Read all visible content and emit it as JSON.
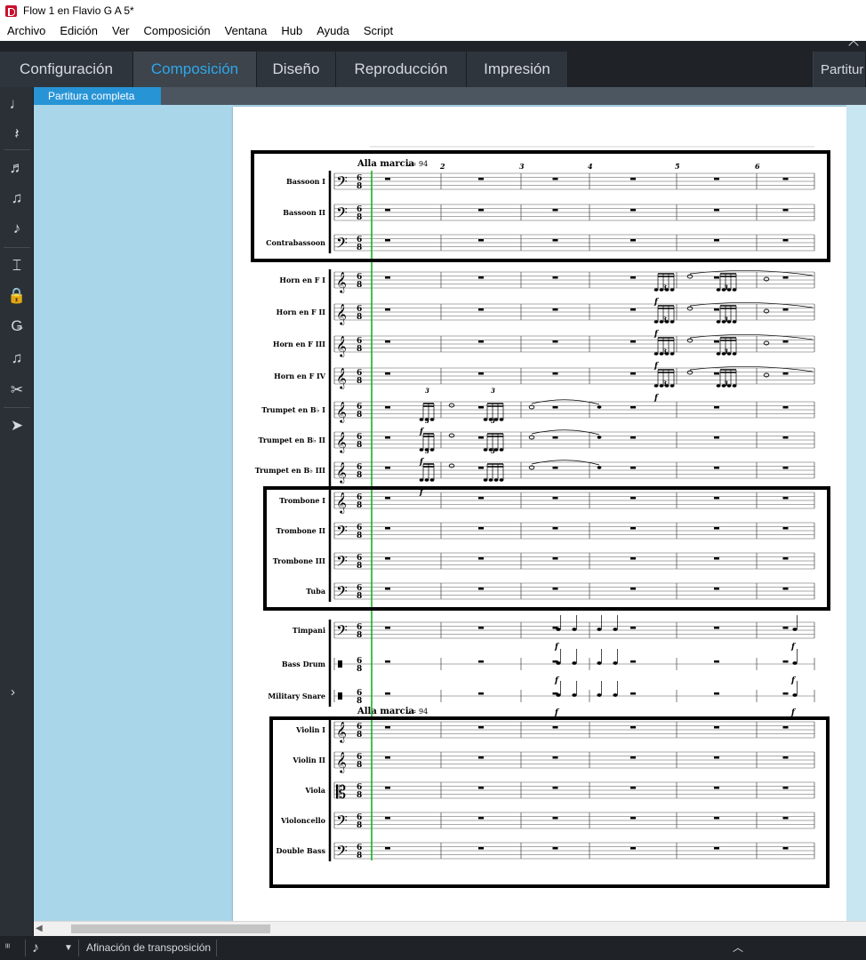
{
  "window": {
    "title": "Flow 1 en Flavio G A 5*"
  },
  "menu": [
    "Archivo",
    "Edición",
    "Ver",
    "Composición",
    "Ventana",
    "Hub",
    "Ayuda",
    "Script"
  ],
  "modes": [
    {
      "label": "Configuración",
      "active": false
    },
    {
      "label": "Composición",
      "active": true
    },
    {
      "label": "Diseño",
      "active": false
    },
    {
      "label": "Reproducción",
      "active": false
    },
    {
      "label": "Impresión",
      "active": false
    }
  ],
  "layout_selector": "Partitur",
  "layout_tab": "Partitura completa",
  "toolbox": [
    {
      "name": "note-input-icon",
      "glyph": "♩"
    },
    {
      "name": "rest-icon",
      "glyph": "𝄽"
    },
    {
      "name": "chord-icon",
      "glyph": "♬"
    },
    {
      "name": "tuplet-icon",
      "glyph": "♫"
    },
    {
      "name": "grace-note-icon",
      "glyph": "♪"
    },
    {
      "name": "insert-icon",
      "glyph": "⌶"
    },
    {
      "name": "lock-duration-icon",
      "glyph": "🔒"
    },
    {
      "name": "force-duration-icon",
      "glyph": "Ǥ"
    },
    {
      "name": "tie-icon",
      "glyph": "♫"
    },
    {
      "name": "scissors-icon",
      "glyph": "✂"
    },
    {
      "name": "select-arrow-icon",
      "glyph": "➤"
    }
  ],
  "accent_color": "#2fa7ea",
  "score": {
    "tempo_marking": "Alla marcia",
    "tempo_value": "= 94",
    "measure_numbers": [
      "2",
      "3",
      "4",
      "5",
      "6"
    ],
    "dynamic": "f",
    "tuplet": "3",
    "instruments": [
      "Bassoon I",
      "Bassoon II",
      "Contrabassoon",
      "Horn en F I",
      "Horn en F II",
      "Horn en F III",
      "Horn en F IV",
      "Trumpet en B♭ I",
      "Trumpet en B♭ II",
      "Trumpet en B♭ III",
      "Trombone I",
      "Trombone II",
      "Trombone III",
      "Tuba",
      "Timpani",
      "Bass Drum",
      "Military Snare",
      "Violin I",
      "Violin II",
      "Viola",
      "Violoncello",
      "Double Bass"
    ]
  },
  "status": {
    "transposition_label": "Afinación de transposición"
  }
}
